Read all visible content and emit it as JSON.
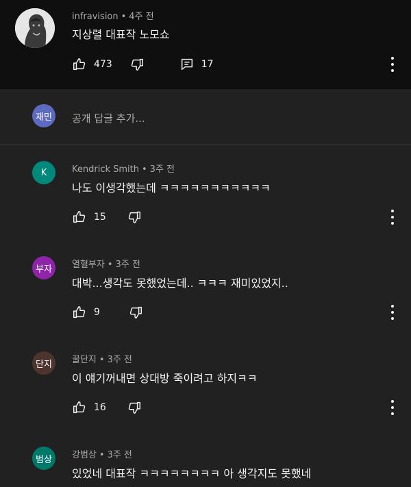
{
  "main_comment": {
    "author": "infravision",
    "time": "4주 전",
    "text": "지상렬 대표작 노모쇼",
    "likes": "473",
    "replies": "17"
  },
  "reply_box": {
    "avatar_text": "재민",
    "avatar_color": "#5c6bc0",
    "placeholder": "공개 답글 추가..."
  },
  "replies": [
    {
      "avatar_text": "K",
      "avatar_color": "#00897b",
      "author": "Kendrick Smith",
      "time": "3주 전",
      "text": "나도 이생각했는데 ㅋㅋㅋㅋㅋㅋㅋㅋㅋㅋㅋ",
      "likes": "15"
    },
    {
      "avatar_text": "부자",
      "avatar_color": "#8e24aa",
      "author": "열혈부자",
      "time": "3주 전",
      "text": "대박...생각도 못했었는데.. ㅋㅋㅋ 재미있었지..",
      "likes": "9"
    },
    {
      "avatar_text": "단지",
      "avatar_color": "#4e342e",
      "author": "꿀단지",
      "time": "3주 전",
      "text": "이 얘기꺼내면 상대방 죽이려고 하지ㅋㅋ",
      "likes": "16"
    },
    {
      "avatar_text": "범상",
      "avatar_color": "#00796b",
      "author": "강범상",
      "time": "3주 전",
      "text": "있었네 대표작 ㅋㅋㅋㅋㅋㅋㅋㅋ 아 생각지도 못했네"
    }
  ],
  "icons": {
    "like": "thumbs-up-icon",
    "dislike": "thumbs-down-icon",
    "reply": "comment-icon",
    "more": "more-vertical-icon"
  },
  "colors": {
    "background": "#212121",
    "header_background": "#0f0f0f",
    "secondary_text": "#aaaaaa"
  }
}
